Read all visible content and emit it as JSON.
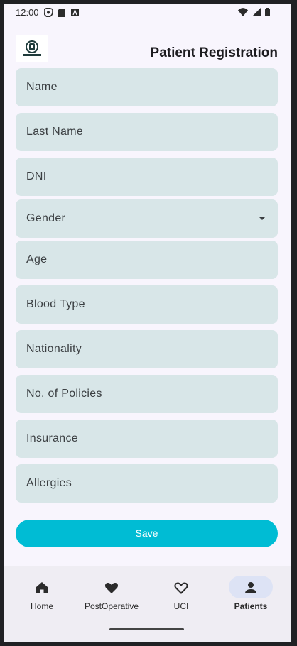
{
  "status_bar": {
    "time": "12:00"
  },
  "header": {
    "title": "Patient Registration",
    "logo_icon": "hospital-logo-icon"
  },
  "form": {
    "fields": [
      {
        "label": "Name"
      },
      {
        "label": "Last Name"
      },
      {
        "label": "DNI"
      },
      {
        "label": "Gender",
        "type": "dropdown"
      },
      {
        "label": "Age"
      },
      {
        "label": "Blood Type"
      },
      {
        "label": "Nationality"
      },
      {
        "label": "No. of Policies"
      },
      {
        "label": "Insurance"
      },
      {
        "label": "Allergies"
      }
    ],
    "save_label": "Save"
  },
  "bottom_nav": {
    "items": [
      {
        "label": "Home",
        "icon": "home-icon",
        "active": false
      },
      {
        "label": "PostOperative",
        "icon": "heart-filled-icon",
        "active": false
      },
      {
        "label": "UCI",
        "icon": "heart-outline-icon",
        "active": false
      },
      {
        "label": "Patients",
        "icon": "person-icon",
        "active": true
      }
    ]
  },
  "colors": {
    "field_bg": "#d8e6e8",
    "accent": "#00bcd4",
    "active_nav_pill": "#dde3f5"
  }
}
